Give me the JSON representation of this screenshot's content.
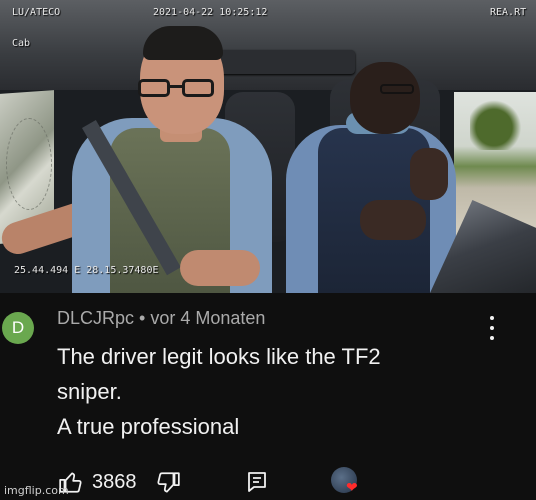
{
  "dashcam": {
    "timestamp": "2021-04-22  10:25:12",
    "top_left_label": "Cab",
    "top_left_code": "LU/ATECO",
    "top_right_code": "REA.RT",
    "gps": "25.44.494 E 28.15.37480E"
  },
  "comment": {
    "avatar_letter": "D",
    "avatar_color": "#6aa84f",
    "author": "DLCJRpc",
    "separator": "•",
    "time": "vor 4 Monaten",
    "lines": [
      "The driver legit looks like the TF2",
      "sniper.",
      "A true professional"
    ],
    "like_count": "3868",
    "text_color": "#f1f1f1",
    "meta_color": "#aaaaaa",
    "background": "#0f0f0f"
  },
  "icons": {
    "like": "thumbs-up-icon",
    "dislike": "thumbs-down-icon",
    "reply": "reply-icon",
    "more": "more-vert-icon",
    "heart": "heart-icon"
  },
  "watermark": "imgflip.com"
}
